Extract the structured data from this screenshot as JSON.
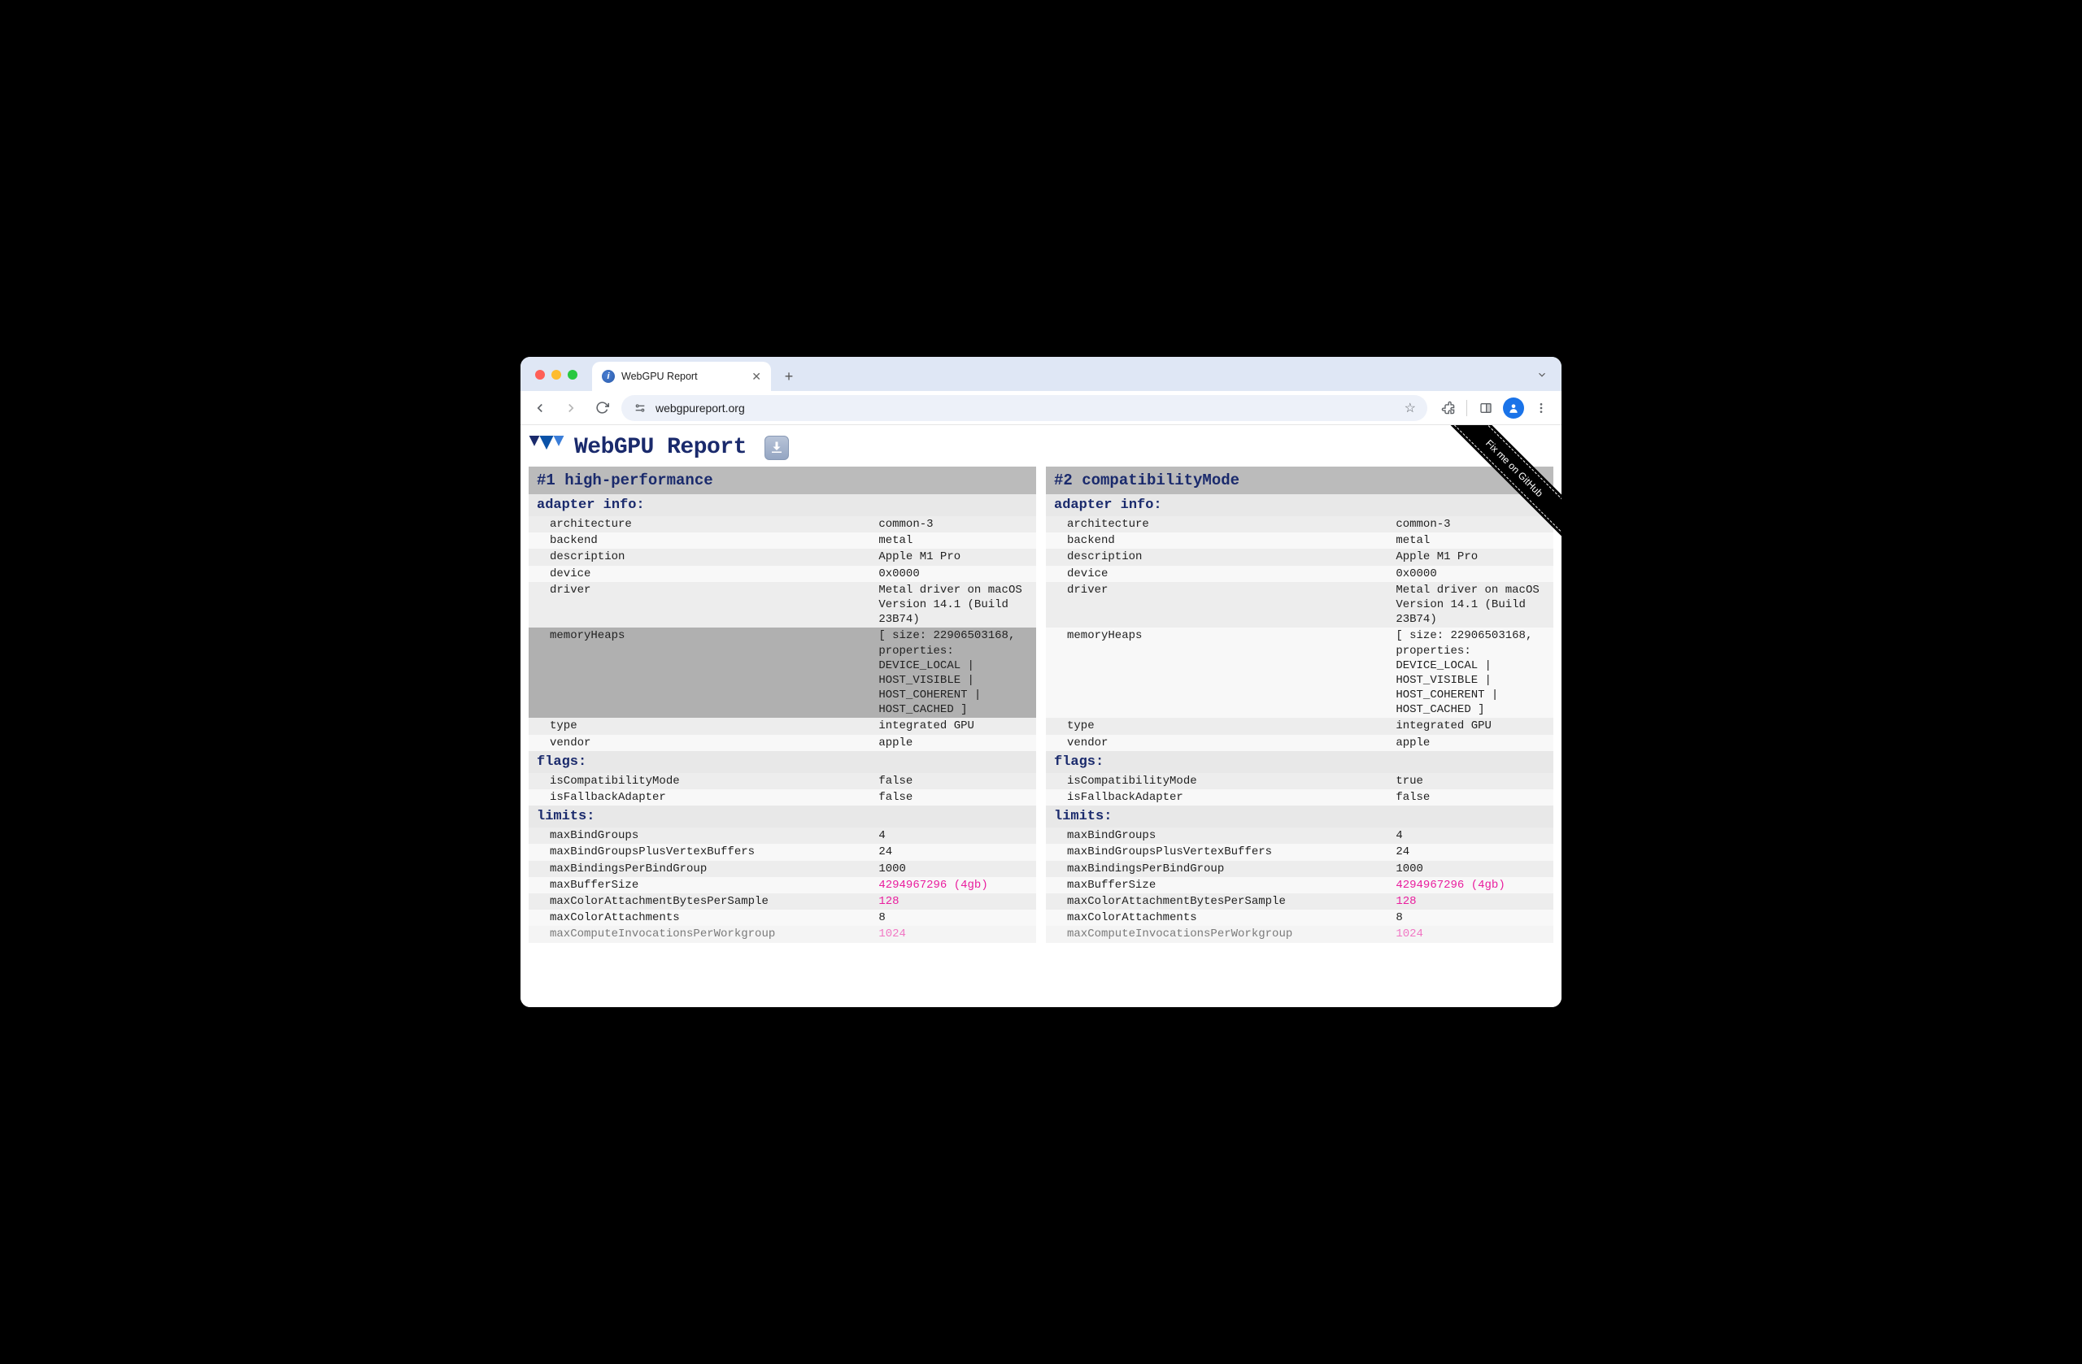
{
  "browser": {
    "tab_title": "WebGPU Report",
    "url": "webgpureport.org"
  },
  "page": {
    "title": "WebGPU Report",
    "github_ribbon": "Fix me on GitHub"
  },
  "panels": [
    {
      "title": "#1 high-performance",
      "sections": [
        {
          "title": "adapter info:",
          "rows": [
            {
              "key": "architecture",
              "value": "common-3"
            },
            {
              "key": "backend",
              "value": "metal"
            },
            {
              "key": "description",
              "value": "Apple M1 Pro"
            },
            {
              "key": "device",
              "value": "0x0000"
            },
            {
              "key": "driver",
              "value": "Metal driver on macOS Version 14.1 (Build 23B74)"
            },
            {
              "key": "memoryHeaps",
              "value": "[ size: 22906503168, properties: DEVICE_LOCAL | HOST_VISIBLE | HOST_COHERENT | HOST_CACHED ]",
              "highlighted": true
            },
            {
              "key": "type",
              "value": "integrated GPU"
            },
            {
              "key": "vendor",
              "value": "apple"
            }
          ]
        },
        {
          "title": "flags:",
          "rows": [
            {
              "key": "isCompatibilityMode",
              "value": "false"
            },
            {
              "key": "isFallbackAdapter",
              "value": "false"
            }
          ]
        },
        {
          "title": "limits:",
          "rows": [
            {
              "key": "maxBindGroups",
              "value": "4"
            },
            {
              "key": "maxBindGroupsPlusVertexBuffers",
              "value": "24"
            },
            {
              "key": "maxBindingsPerBindGroup",
              "value": "1000"
            },
            {
              "key": "maxBufferSize",
              "value": "4294967296 (4gb)",
              "pink": true
            },
            {
              "key": "maxColorAttachmentBytesPerSample",
              "value": "128",
              "pink": true
            },
            {
              "key": "maxColorAttachments",
              "value": "8"
            },
            {
              "key": "maxComputeInvocationsPerWorkgroup",
              "value": "1024",
              "pink": true,
              "truncated": true
            }
          ]
        }
      ]
    },
    {
      "title": "#2 compatibilityMode",
      "sections": [
        {
          "title": "adapter info:",
          "rows": [
            {
              "key": "architecture",
              "value": "common-3"
            },
            {
              "key": "backend",
              "value": "metal"
            },
            {
              "key": "description",
              "value": "Apple M1 Pro"
            },
            {
              "key": "device",
              "value": "0x0000"
            },
            {
              "key": "driver",
              "value": "Metal driver on macOS Version 14.1 (Build 23B74)"
            },
            {
              "key": "memoryHeaps",
              "value": "[ size: 22906503168, properties: DEVICE_LOCAL | HOST_VISIBLE | HOST_COHERENT | HOST_CACHED ]"
            },
            {
              "key": "type",
              "value": "integrated GPU"
            },
            {
              "key": "vendor",
              "value": "apple"
            }
          ]
        },
        {
          "title": "flags:",
          "rows": [
            {
              "key": "isCompatibilityMode",
              "value": "true"
            },
            {
              "key": "isFallbackAdapter",
              "value": "false"
            }
          ]
        },
        {
          "title": "limits:",
          "rows": [
            {
              "key": "maxBindGroups",
              "value": "4"
            },
            {
              "key": "maxBindGroupsPlusVertexBuffers",
              "value": "24"
            },
            {
              "key": "maxBindingsPerBindGroup",
              "value": "1000"
            },
            {
              "key": "maxBufferSize",
              "value": "4294967296 (4gb)",
              "pink": true
            },
            {
              "key": "maxColorAttachmentBytesPerSample",
              "value": "128",
              "pink": true
            },
            {
              "key": "maxColorAttachments",
              "value": "8"
            },
            {
              "key": "maxComputeInvocationsPerWorkgroup",
              "value": "1024",
              "pink": true,
              "truncated": true
            }
          ]
        }
      ]
    }
  ]
}
